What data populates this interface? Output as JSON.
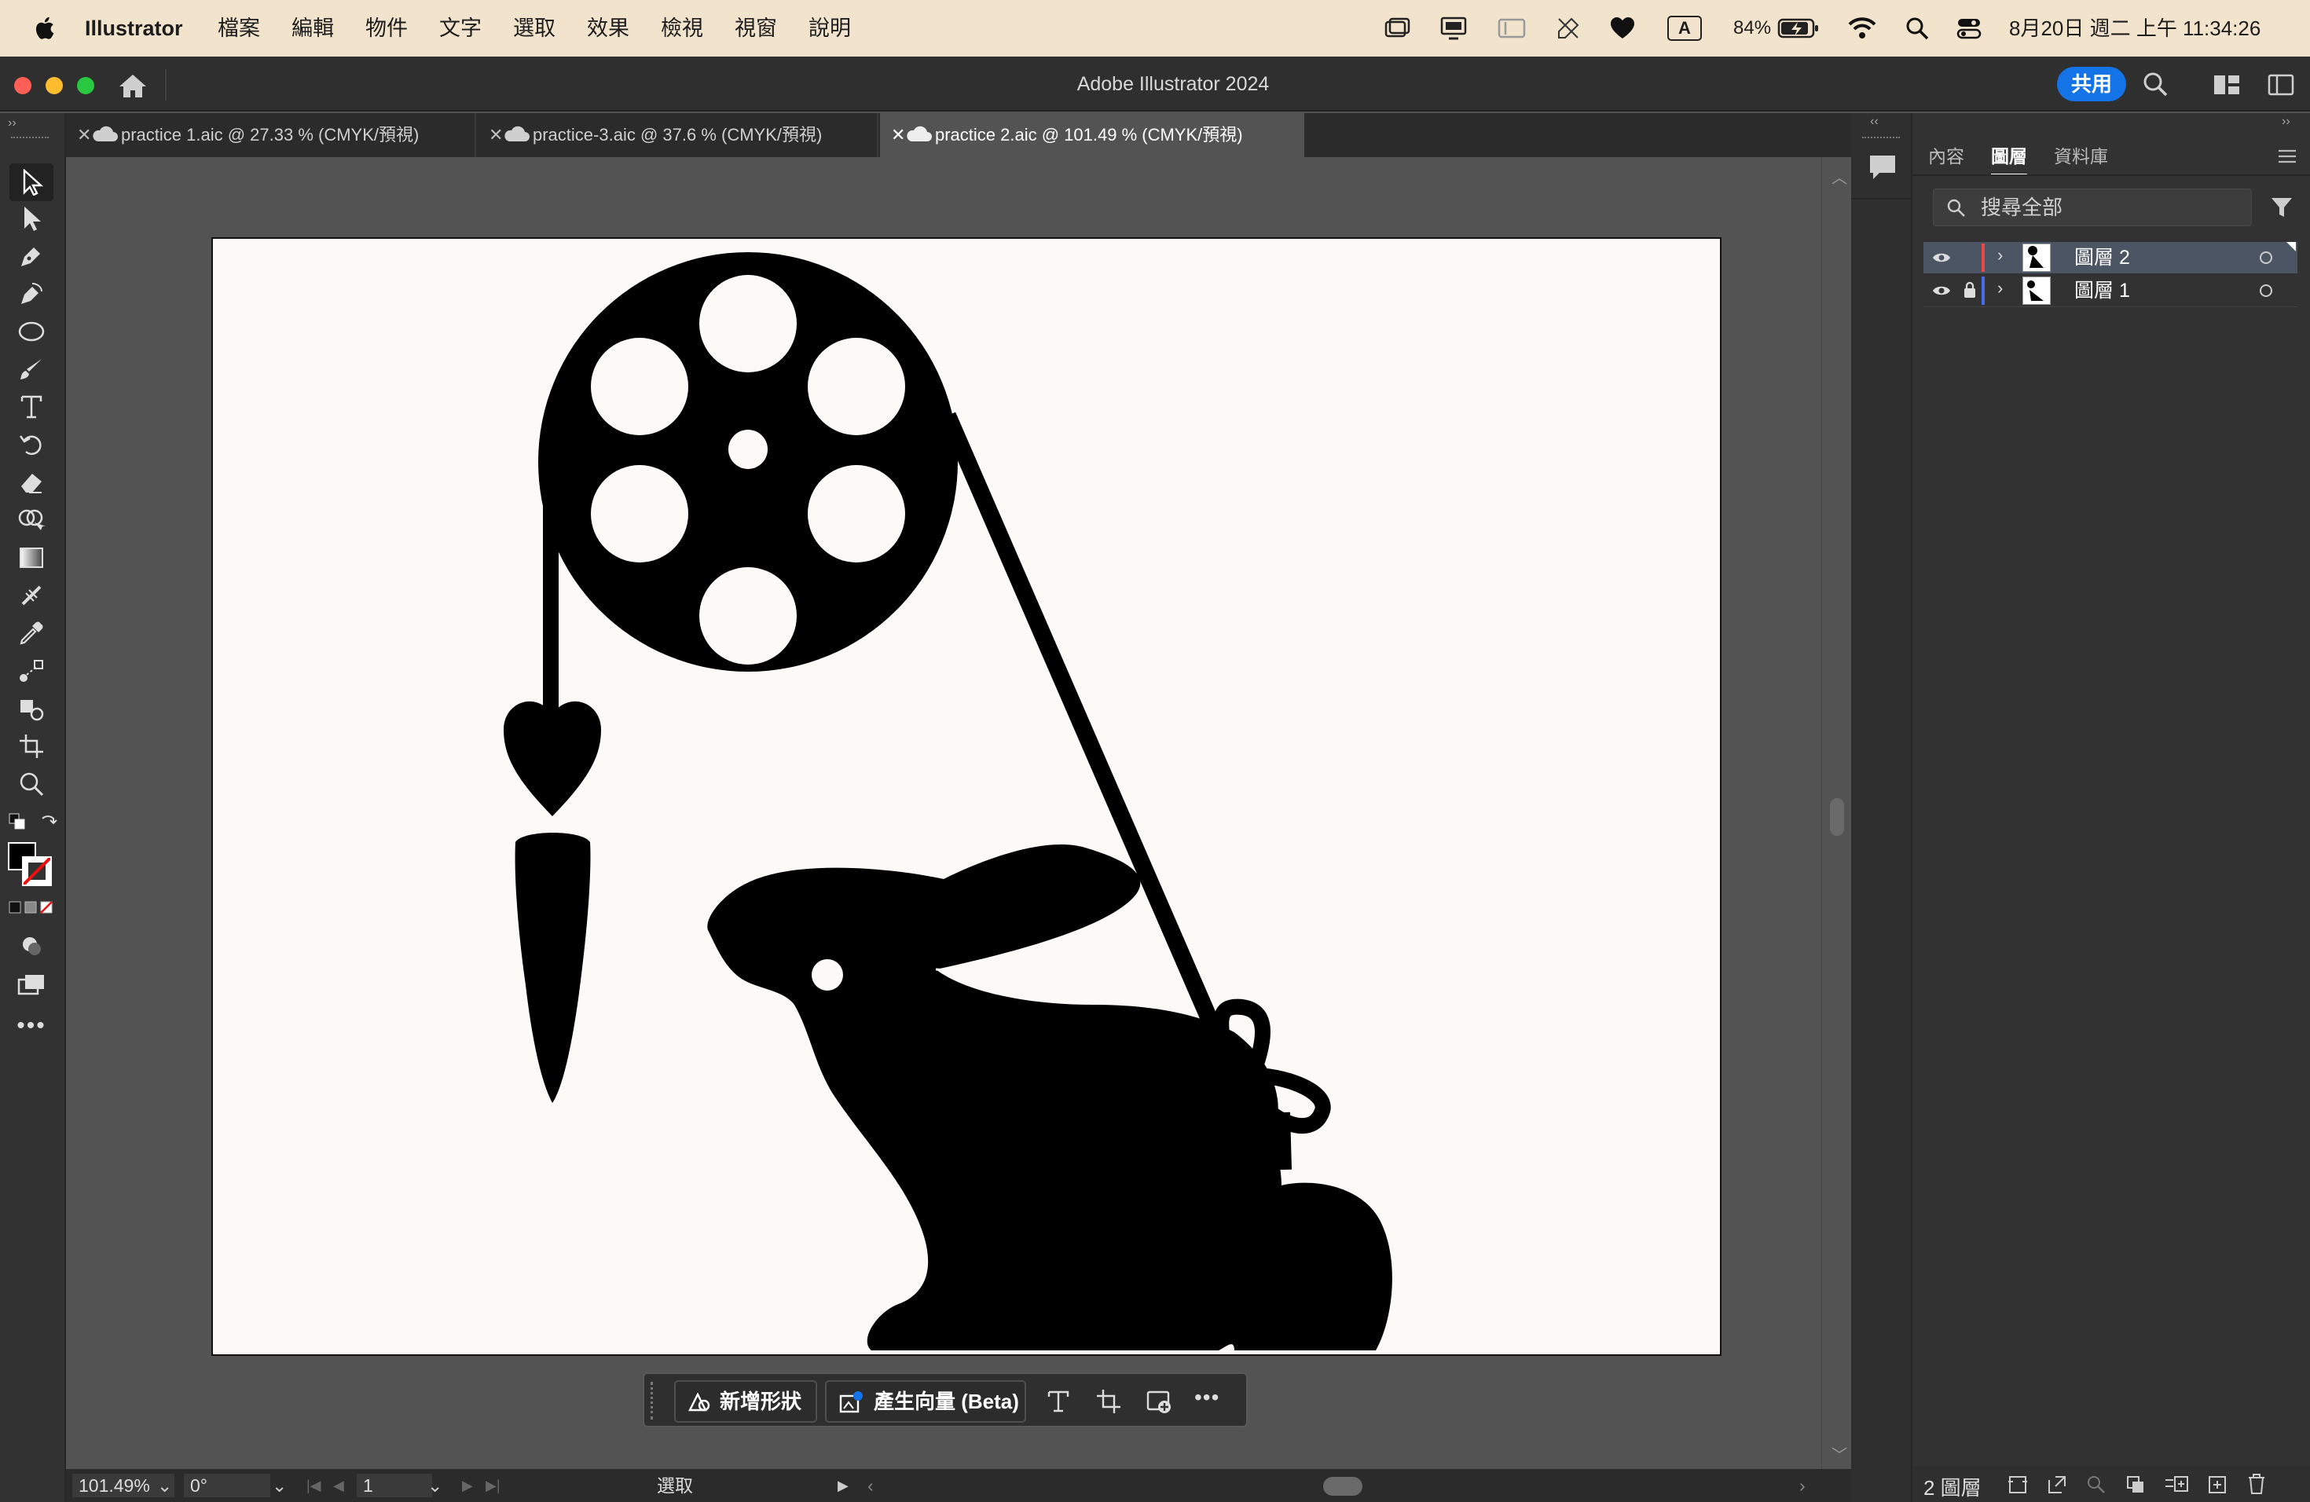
{
  "menubar": {
    "app_name": "Illustrator",
    "items": [
      "檔案",
      "編輯",
      "物件",
      "文字",
      "選取",
      "效果",
      "檢視",
      "視窗",
      "說明"
    ],
    "battery": "84%",
    "input_method": "A",
    "datetime": "8月20日 週二 上午 11:34:26"
  },
  "window": {
    "title": "Adobe Illustrator 2024",
    "share_label": "共用"
  },
  "tabs": [
    {
      "label": "practice 1.aic @ 27.33 % (CMYK/預視)",
      "active": false
    },
    {
      "label": "practice-3.aic @ 37.6 % (CMYK/預視)",
      "active": false
    },
    {
      "label": "practice 2.aic @ 101.49 % (CMYK/預視)",
      "active": true
    }
  ],
  "tools": [
    "selection-tool",
    "direct-selection-tool",
    "pen-tool",
    "curvature-tool",
    "ellipse-tool",
    "paintbrush-tool",
    "type-tool",
    "rotate-tool",
    "eraser-tool",
    "shape-builder-tool",
    "gradient-tool",
    "eyedropper-tool",
    "blend-tool",
    "puppet-warp-tool",
    "artboard-tool",
    "zoom-tool"
  ],
  "context_bar": {
    "new_shape_label": "新增形狀",
    "generate_vector_label": "產生向量 (Beta)"
  },
  "layers_panel": {
    "tabs": [
      "內容",
      "圖層",
      "資料庫"
    ],
    "active_tab": "圖層",
    "search_placeholder": "搜尋全部",
    "layers": [
      {
        "name": "圖層 2",
        "color": "#e84a4a",
        "locked": false,
        "selected": true
      },
      {
        "name": "圖層 1",
        "color": "#4a6ce8",
        "locked": true,
        "selected": false
      }
    ],
    "footer_count": "2 圖層"
  },
  "statusbar": {
    "zoom": "101.49",
    "rotation": "0°",
    "artboard_number": "1",
    "tool_name": "選取"
  },
  "colors": {
    "accent": "#1473e6",
    "menubar_bg": "#f2e3cc",
    "ui_dark": "#323232",
    "canvas_bg": "#535353",
    "artboard_bg": "#fbfaf6"
  }
}
